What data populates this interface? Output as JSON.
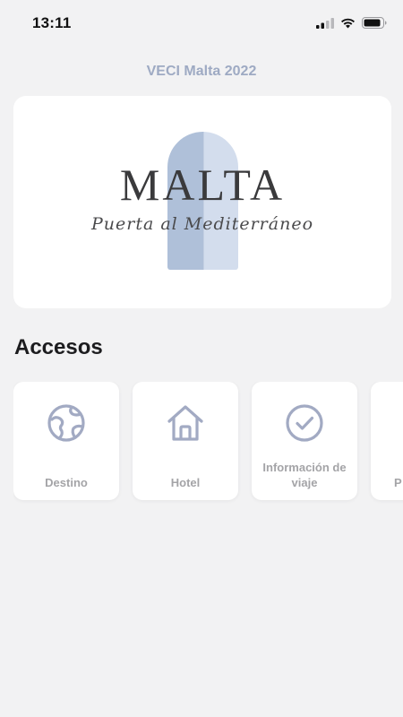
{
  "status_bar": {
    "time": "13:11"
  },
  "header": {
    "title": "VECI Malta 2022"
  },
  "banner": {
    "logo_word": "MALTA",
    "logo_tagline": "Puerta al Mediterráneo"
  },
  "accesos": {
    "title": "Accesos",
    "items": [
      {
        "label": "Destino",
        "icon": "globe-icon"
      },
      {
        "label": "Hotel",
        "icon": "home-icon"
      },
      {
        "label": "Información de viaje",
        "icon": "check-circle-icon"
      },
      {
        "label": "P",
        "icon": "unknown-icon"
      }
    ]
  },
  "colors": {
    "background": "#f2f2f3",
    "accent": "#9eaac3",
    "tile_text": "#a4a4a7",
    "arch_left": "#afc0d9",
    "arch_right": "#d3dded"
  }
}
